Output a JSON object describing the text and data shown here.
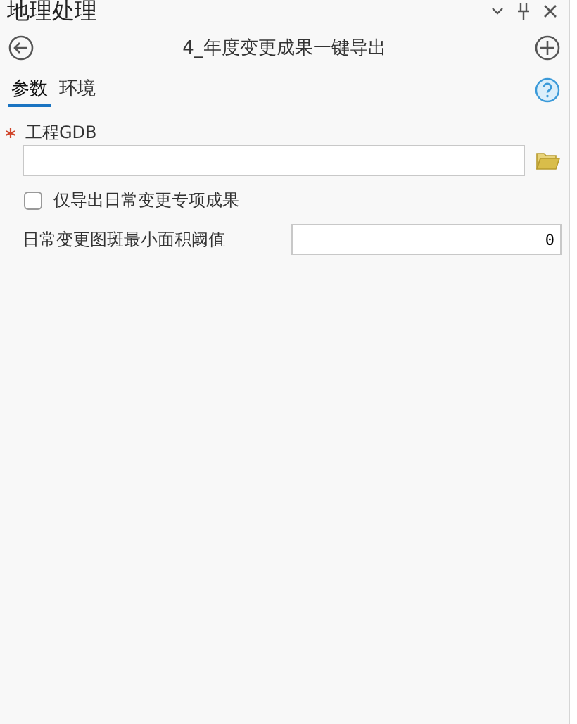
{
  "pane": {
    "title": "地理处理"
  },
  "tool": {
    "title": "4_年度变更成果一键导出"
  },
  "tabs": [
    {
      "label": "参数",
      "selected": true
    },
    {
      "label": "环境",
      "selected": false
    }
  ],
  "parameters": [
    {
      "kind": "path",
      "label": "工程GDB",
      "required": true
    },
    {
      "kind": "checkbox",
      "label": "仅导出日常变更专项成果",
      "checked": false
    },
    {
      "kind": "number",
      "label": "日常变更图斑最小面积阈值",
      "value": "0"
    }
  ]
}
